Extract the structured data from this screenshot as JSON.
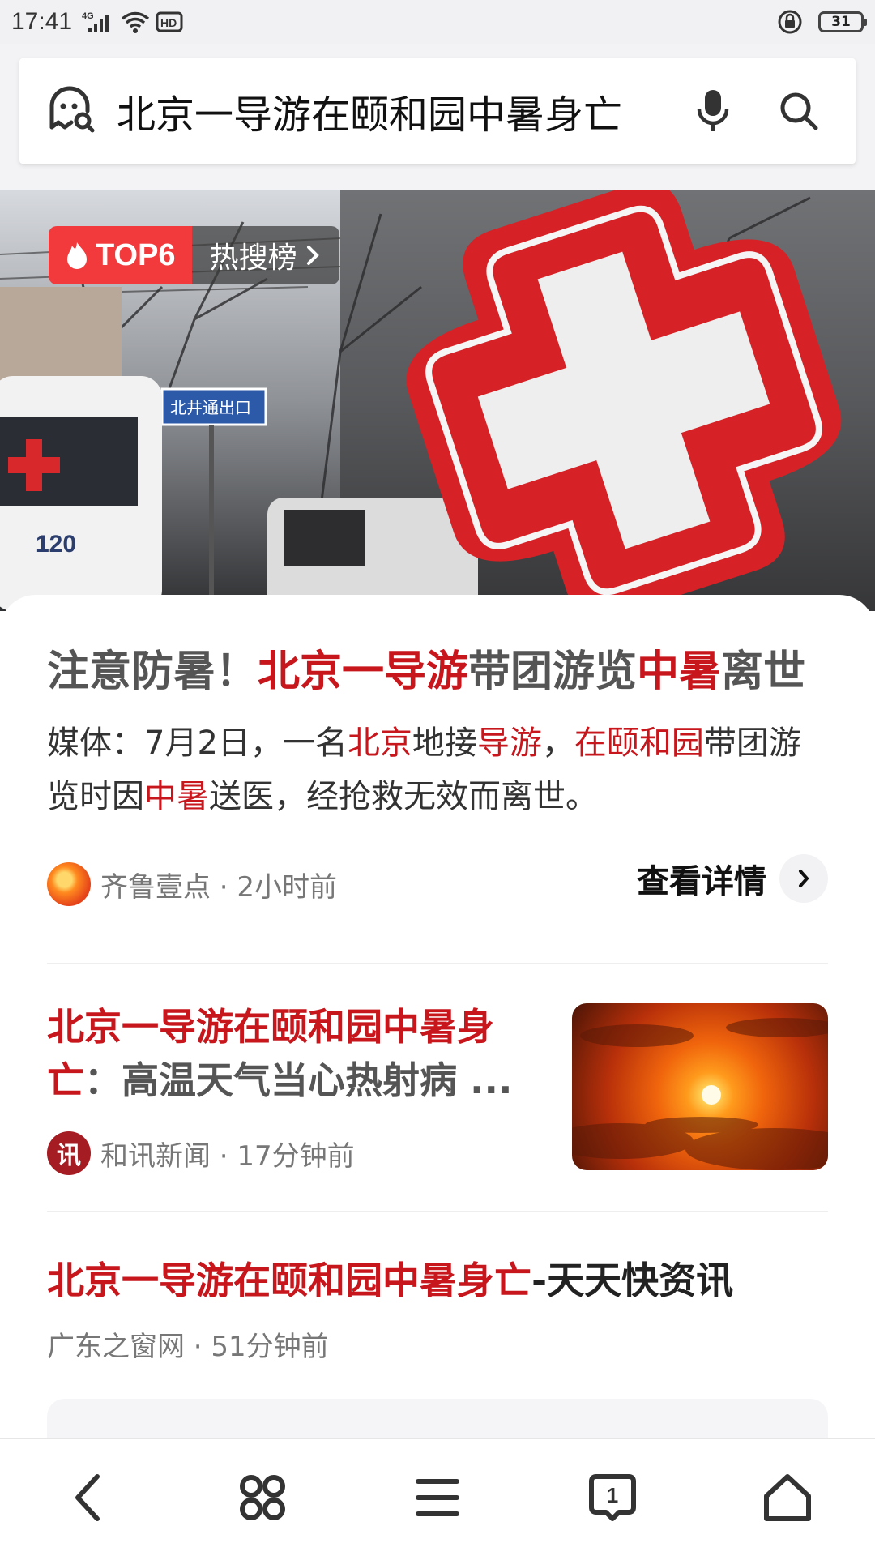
{
  "status_bar": {
    "time": "17:41",
    "network": "4G",
    "hd": "HD",
    "battery": "31"
  },
  "search": {
    "query": "北京一导游在颐和园中暑身亡"
  },
  "hero": {
    "badge_rank": "TOP6",
    "badge_label": "热搜榜",
    "sign_text": "北井通出口",
    "vehicle_number": "120"
  },
  "main_card": {
    "headline": [
      {
        "text": "注意防暑！",
        "hl": false
      },
      {
        "text": "北京一导游",
        "hl": true
      },
      {
        "text": "带团游览",
        "hl": false
      },
      {
        "text": "中暑",
        "hl": true
      },
      {
        "text": "离世",
        "hl": false
      }
    ],
    "summary": [
      {
        "text": "媒体：7月2日，一名",
        "hl": false
      },
      {
        "text": "北京",
        "hl": true
      },
      {
        "text": "地接",
        "hl": false
      },
      {
        "text": "导游",
        "hl": true
      },
      {
        "text": "，",
        "hl": false
      },
      {
        "text": "在颐和园",
        "hl": true
      },
      {
        "text": "带团游览时因",
        "hl": false
      },
      {
        "text": "中暑",
        "hl": true
      },
      {
        "text": "送医，经抢救无效而离世。",
        "hl": false
      }
    ],
    "source": "齐鲁壹点 · 2小时前",
    "detail_label": "查看详情"
  },
  "results": [
    {
      "title_hl": "北京一导游在颐和园中暑身亡",
      "title_rest": "：高温天气当心热射病 ...",
      "source": "和讯新闻 · 17分钟前",
      "avatar_text": "讯"
    },
    {
      "title_hl": "北京一导游在颐和园中暑身亡",
      "title_rest": "-天天快资讯",
      "source": "广东之窗网 · 51分钟前"
    }
  ],
  "colors": {
    "highlight": "#c7161c",
    "badge_red": "#f23a3c"
  },
  "icons": {
    "search_logo": "ghost-search-icon",
    "voice": "microphone-icon",
    "search": "magnifier-icon",
    "nav": [
      "back-icon",
      "apps-icon",
      "menu-icon",
      "tabs-icon",
      "home-icon"
    ],
    "tabs_count": "1"
  }
}
